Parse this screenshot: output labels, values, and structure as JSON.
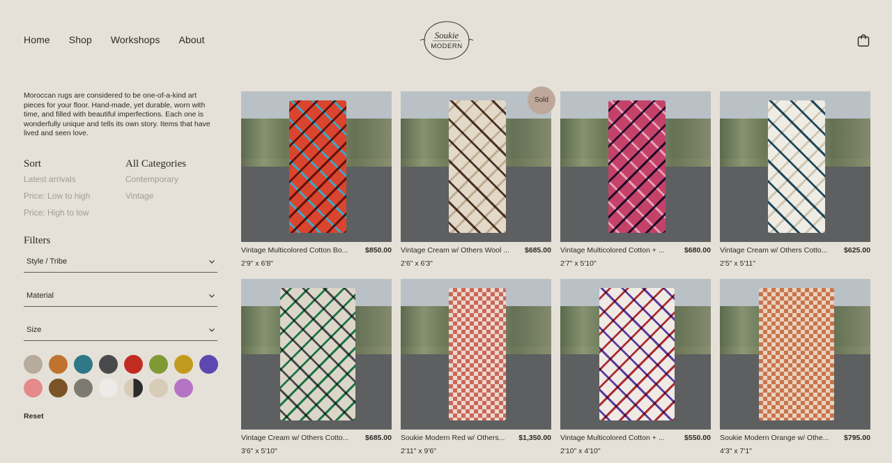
{
  "nav": {
    "items": [
      {
        "label": "Home"
      },
      {
        "label": "Shop"
      },
      {
        "label": "Workshops"
      },
      {
        "label": "About"
      }
    ]
  },
  "logo": {
    "line1": "Soukie",
    "line2": "MODERN"
  },
  "cart": {
    "icon": "shopping-bag-icon"
  },
  "intro": "Moroccan rugs are considered to be one-of-a-kind art pieces for your floor. Hand-made, yet durable, worn with time, and filled with beautiful imperfections. Each one is wonderfully unique and tells its own story. Items that have lived and seen love.",
  "sort": {
    "title": "Sort",
    "options": [
      "Latest arrivals",
      "Price: Low to high",
      "Price: High to low"
    ]
  },
  "categories": {
    "title": "All Categories",
    "options": [
      "Contemporary",
      "Vintage"
    ]
  },
  "filters": {
    "title": "Filters",
    "dropdowns": [
      "Style / Tribe",
      "Material",
      "Size"
    ],
    "swatch_colors": [
      "#b6ab9d",
      "#c0732e",
      "#2f7887",
      "#4a4a4c",
      "#c22b22",
      "#7f9a33",
      "#c29b1e",
      "#5c49b0",
      "#e48a8a",
      "#7a5427",
      "#7d7a72",
      "#ecebe8",
      "#ddd0b5",
      "#d6ccb8",
      "#b573c4"
    ],
    "reset_label": "Reset"
  },
  "products": [
    {
      "name": "Vintage Multicolored Cotton Bo...",
      "price": "$850.00",
      "size": "2'9\" x 6'8\"",
      "colors": [
        "#d9452e",
        "#3da7c7",
        "#7a3a2a"
      ]
    },
    {
      "name": "Vintage Cream w/ Others Wool ...",
      "price": "$685.00",
      "size": "2'6\" x 6'3\"",
      "colors": [
        "#e3d9c8",
        "#4a3226",
        "#d6cbb9"
      ],
      "badge": "Sold"
    },
    {
      "name": "Vintage Multicolored Cotton + ...",
      "price": "$680.00",
      "size": "2'7\" x 5'10\"",
      "colors": [
        "#c4426a",
        "#e8a3b8",
        "#2a2a5a"
      ]
    },
    {
      "name": "Vintage Cream w/ Others Cotto...",
      "price": "$625.00",
      "size": "2'5\" x 5'11\"",
      "colors": [
        "#efece4",
        "#1f4a5e",
        "#dcd6c8"
      ]
    },
    {
      "name": "Vintage Cream w/ Others Cotto...",
      "price": "$685.00",
      "size": "3'6\" x 5'10\"",
      "colors": [
        "#dcd6c9",
        "#48484a",
        "#1f8a5a"
      ]
    },
    {
      "name": "Soukie Modern Red w/ Others...",
      "price": "$1,350.00",
      "size": "2'11\" x 9'6\"",
      "colors": [
        "#c9685a",
        "#ecd8cc",
        "#b9564a"
      ]
    },
    {
      "name": "Vintage Multicolored Cotton + ...",
      "price": "$550.00",
      "size": "2'10\" x 4'10\"",
      "colors": [
        "#efeae4",
        "#5b3aa0",
        "#b6303a"
      ]
    },
    {
      "name": "Soukie Modern Orange w/ Othe...",
      "price": "$795.00",
      "size": "4'3\" x 7'1\"",
      "colors": [
        "#c9744e",
        "#e9d3bd",
        "#b8623e"
      ]
    }
  ]
}
